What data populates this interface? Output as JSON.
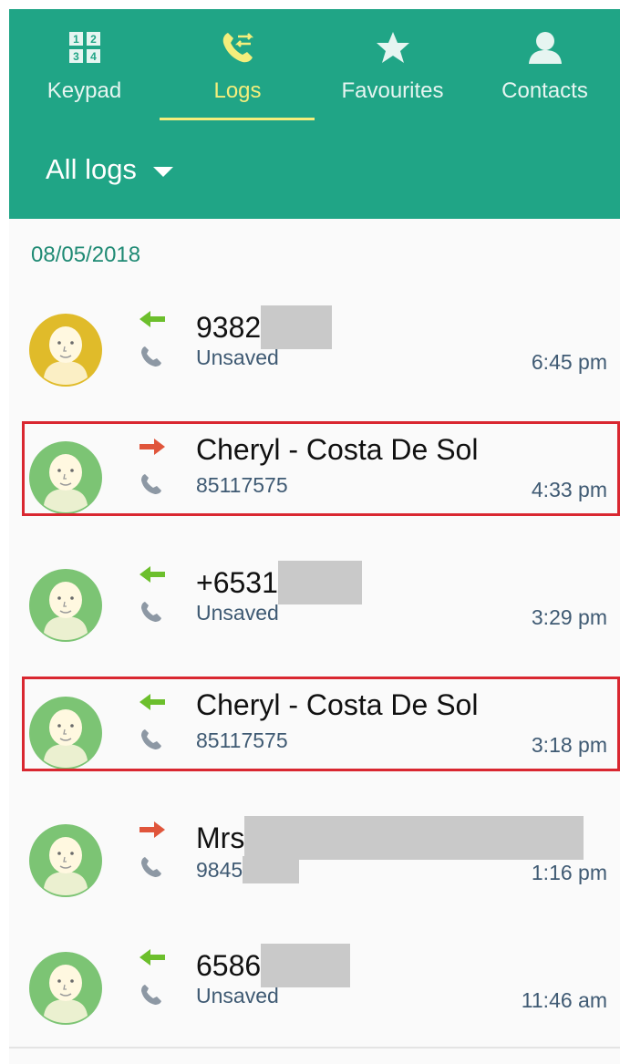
{
  "colors": {
    "header_bg": "#20a586",
    "active_tab": "#f4ee7c",
    "incoming_arrow": "#6cbf2c",
    "outgoing_arrow": "#e0553b",
    "highlight_border": "#d92730"
  },
  "tabs": [
    {
      "label": "Keypad",
      "icon": "keypad-icon",
      "active": false
    },
    {
      "label": "Logs",
      "icon": "call-log-icon",
      "active": true
    },
    {
      "label": "Favourites",
      "icon": "star-icon",
      "active": false
    },
    {
      "label": "Contacts",
      "icon": "person-icon",
      "active": false
    }
  ],
  "filter": {
    "label": "All logs",
    "icon": "caret-down-icon"
  },
  "date_header": "08/05/2018",
  "calls": [
    {
      "name": "9382",
      "name_redacted": true,
      "number": "Unsaved",
      "number_redacted": false,
      "time": "6:45 pm",
      "direction": "incoming",
      "avatar": "yellow",
      "highlighted": false
    },
    {
      "name": "Cheryl - Costa De Sol",
      "name_redacted": false,
      "number": "85117575",
      "number_redacted": false,
      "time": "4:33 pm",
      "direction": "outgoing",
      "avatar": "green",
      "highlighted": true
    },
    {
      "name": "+6531",
      "name_redacted": true,
      "number": "Unsaved",
      "number_redacted": false,
      "time": "3:29 pm",
      "direction": "incoming",
      "avatar": "green",
      "highlighted": false
    },
    {
      "name": "Cheryl - Costa De Sol",
      "name_redacted": false,
      "number": "85117575",
      "number_redacted": false,
      "time": "3:18 pm",
      "direction": "incoming",
      "avatar": "green",
      "highlighted": true
    },
    {
      "name": "Mrs",
      "name_redacted": true,
      "number": "9845",
      "number_redacted": true,
      "time": "1:16 pm",
      "direction": "outgoing",
      "avatar": "green",
      "highlighted": false
    },
    {
      "name": "6586",
      "name_redacted": true,
      "number": "Unsaved",
      "number_redacted": false,
      "time": "11:46 am",
      "direction": "incoming",
      "avatar": "green",
      "highlighted": false
    }
  ]
}
